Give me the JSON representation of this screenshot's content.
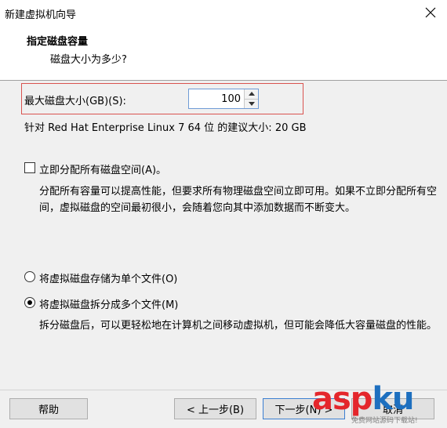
{
  "window": {
    "title": "新建虚拟机向导",
    "close_icon": "close-icon"
  },
  "header": {
    "title": "指定磁盘容量",
    "subtitle": "磁盘大小为多少?"
  },
  "disk": {
    "size_label": "最大磁盘大小(GB)(S):",
    "size_value": "100",
    "recommendation": "针对 Red Hat Enterprise Linux 7 64 位 的建议大小: 20 GB"
  },
  "allocate": {
    "label": "立即分配所有磁盘空间(A)。",
    "checked": false,
    "description": "分配所有容量可以提高性能，但要求所有物理磁盘空间立即可用。如果不立即分配所有空间，虚拟磁盘的空间最初很小，会随着您向其中添加数据而不断变大。"
  },
  "storage": {
    "options": [
      {
        "label": "将虚拟磁盘存储为单个文件(O)",
        "checked": false
      },
      {
        "label": "将虚拟磁盘拆分成多个文件(M)",
        "checked": true
      }
    ],
    "description": "拆分磁盘后，可以更轻松地在计算机之间移动虚拟机，但可能会降低大容量磁盘的性能。"
  },
  "buttons": {
    "help": "帮助",
    "back": "< 上一步(B)",
    "next": "下一步(N) >",
    "cancel": "取消"
  },
  "watermark": {
    "brand": "aspku",
    "tagline": "免费网站源码下载站!",
    "colors": {
      "asp": "#e4262b",
      "ku": "#1d6fbf"
    }
  },
  "colors": {
    "highlight_border": "#d9534f",
    "focus_border": "#3c7fd1",
    "dialog_bg": "#f0f0f0"
  }
}
